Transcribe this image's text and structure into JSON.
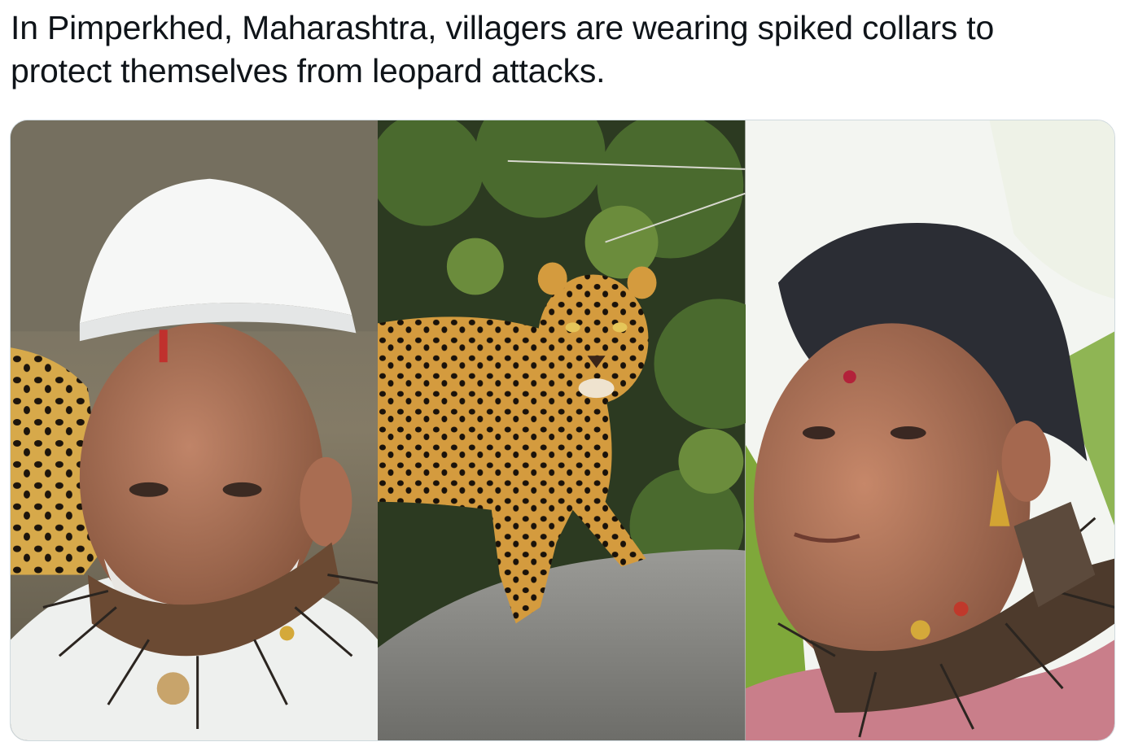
{
  "post": {
    "text": "In Pimperkhed, Maharashtra, villagers are wearing spiked collars to protect themselves from leopard attacks."
  },
  "media": {
    "images": [
      {
        "subject": "elderly-man-white-cap-spiked-collar"
      },
      {
        "subject": "leopard-on-rock"
      },
      {
        "subject": "woman-spiked-collar"
      }
    ]
  }
}
